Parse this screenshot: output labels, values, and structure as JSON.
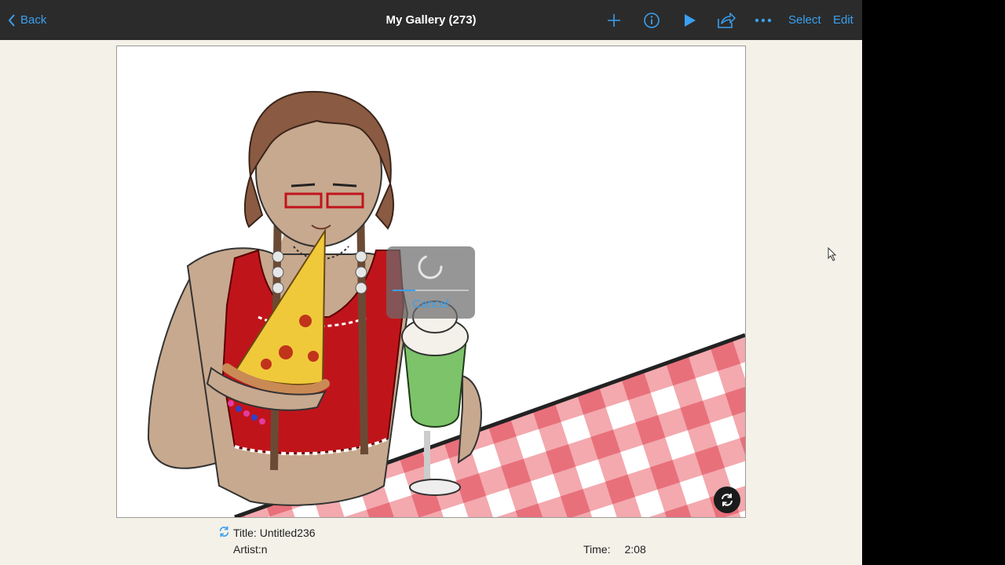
{
  "toolbar": {
    "back_label": "Back",
    "title": "My Gallery (273)",
    "select_label": "Select",
    "edit_label": "Edit",
    "icons": [
      "chevron-left-icon",
      "plus-icon",
      "info-icon",
      "play-icon",
      "share-icon",
      "more-icon"
    ],
    "accent": "#3aa0f0",
    "background": "#2b2b2b"
  },
  "loading": {
    "cancel_label": "Cancel",
    "progress": 0.3
  },
  "artwork": {
    "tablecloth_colors": [
      "#ef8a93",
      "#ffffff"
    ],
    "top_color": "#c0141b",
    "drink_color": "#7cc36a"
  },
  "meta": {
    "title_label": "Title:",
    "title_value": "Untitled236",
    "artist_label": "Artist:",
    "artist_value": "n",
    "time_label": "Time:",
    "time_value": "2:08"
  }
}
